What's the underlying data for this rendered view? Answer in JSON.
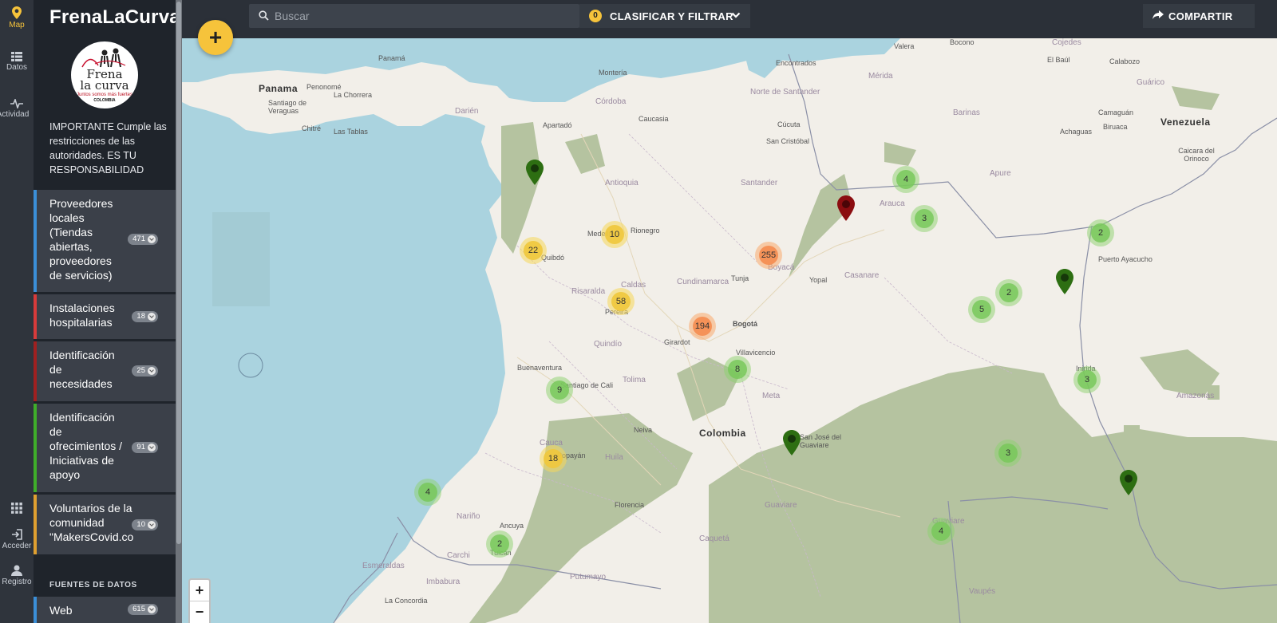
{
  "rail": {
    "items": [
      {
        "label": "Map",
        "icon": "map-pin-icon",
        "active": true
      },
      {
        "label": "Datos",
        "icon": "list-icon"
      },
      {
        "label": "Actividad",
        "icon": "activity-icon"
      },
      {
        "label": "",
        "icon": "apps-grid-icon"
      },
      {
        "label": "Acceder",
        "icon": "login-icon"
      },
      {
        "label": "Registro",
        "icon": "user-icon"
      }
    ]
  },
  "sidebar": {
    "brand": "FrenaLaCurva",
    "logo": {
      "line1": "Frena",
      "line2": "la curva",
      "line3": "Juntos somos más fuertes",
      "line4": "COLOMBIA"
    },
    "notice": "IMPORTANTE Cumple las restricciones de las autoridades. ES TU RESPONSABILIDAD",
    "layers": [
      {
        "label": "Proveedores locales (Tiendas abiertas, proveedores de servicios)",
        "count": "471",
        "color": "#3b8fd8"
      },
      {
        "label": "Instalaciones hospitalarias",
        "count": "18",
        "color": "#d83b3b"
      },
      {
        "label": "Identificación de necesidades",
        "count": "25",
        "color": "#a02020"
      },
      {
        "label": "Identificación de ofrecimientos / Iniciativas de apoyo",
        "count": "91",
        "color": "#3fae2a"
      },
      {
        "label": "Voluntarios de la comunidad \"MakersCovid.co",
        "count": "10",
        "color": "#e0a030"
      }
    ],
    "sources_title": "FUENTES DE DATOS",
    "source_first": {
      "label": "Web",
      "count": "615"
    }
  },
  "topbar": {
    "search_placeholder": "Buscar",
    "filter_count": "0",
    "filter_label": "CLASIFICAR Y FILTRAR",
    "share_label": "COMPARTIR"
  },
  "map": {
    "fab_label": "+",
    "zoom_in": "+",
    "zoom_out": "−",
    "labels": [
      {
        "text": "Panamá",
        "kind": "city"
      },
      {
        "text": "Panama",
        "kind": "country"
      },
      {
        "text": "Venezuela",
        "kind": "country"
      },
      {
        "text": "Colombia",
        "kind": "country"
      },
      {
        "text": "Bogotá",
        "kind": "city"
      },
      {
        "text": "Medellín",
        "kind": "city"
      },
      {
        "text": "Rionegro",
        "kind": "city"
      },
      {
        "text": "Quibdó",
        "kind": "city"
      },
      {
        "text": "Apartadó",
        "kind": "city"
      },
      {
        "text": "Montería",
        "kind": "city"
      },
      {
        "text": "Caucasia",
        "kind": "city"
      },
      {
        "text": "Córdoba",
        "kind": "region"
      },
      {
        "text": "Antioquia",
        "kind": "region"
      },
      {
        "text": "Santander",
        "kind": "region"
      },
      {
        "text": "Norte de Santander",
        "kind": "region"
      },
      {
        "text": "Cúcuta",
        "kind": "city"
      },
      {
        "text": "San Cristóbal",
        "kind": "city"
      },
      {
        "text": "Arauca",
        "kind": "region"
      },
      {
        "text": "Apure",
        "kind": "region"
      },
      {
        "text": "Barinas",
        "kind": "region"
      },
      {
        "text": "Casanare",
        "kind": "region"
      },
      {
        "text": "Yopal",
        "kind": "city"
      },
      {
        "text": "Tunja",
        "kind": "city"
      },
      {
        "text": "Boyacá",
        "kind": "region"
      },
      {
        "text": "Cundinamarca",
        "kind": "region"
      },
      {
        "text": "Girardot",
        "kind": "city"
      },
      {
        "text": "Villavicencio",
        "kind": "city"
      },
      {
        "text": "Meta",
        "kind": "region"
      },
      {
        "text": "Tolima",
        "kind": "region"
      },
      {
        "text": "Quindío",
        "kind": "region"
      },
      {
        "text": "Risaralda",
        "kind": "region"
      },
      {
        "text": "Caldas",
        "kind": "region"
      },
      {
        "text": "Pereira",
        "kind": "city"
      },
      {
        "text": "Buenaventura",
        "kind": "city"
      },
      {
        "text": "Santiago de Cali",
        "kind": "city"
      },
      {
        "text": "Cauca",
        "kind": "region"
      },
      {
        "text": "Popayán",
        "kind": "city"
      },
      {
        "text": "Huila",
        "kind": "region"
      },
      {
        "text": "Neiva",
        "kind": "city"
      },
      {
        "text": "Florencia",
        "kind": "city"
      },
      {
        "text": "Nariño",
        "kind": "region"
      },
      {
        "text": "Ancuya",
        "kind": "city"
      },
      {
        "text": "Tulcán",
        "kind": "city"
      },
      {
        "text": "Esmeraldas",
        "kind": "region"
      },
      {
        "text": "Carchi",
        "kind": "region"
      },
      {
        "text": "Putumayo",
        "kind": "region"
      },
      {
        "text": "Caquetá",
        "kind": "region"
      },
      {
        "text": "Guaviare",
        "kind": "region"
      },
      {
        "text": "San José del Guaviare",
        "kind": "city"
      },
      {
        "text": "Vaupés",
        "kind": "region"
      },
      {
        "text": "Amazonas",
        "kind": "region"
      },
      {
        "text": "Puerto Ayacucho",
        "kind": "city"
      },
      {
        "text": "Caicara del Orinoco",
        "kind": "city"
      },
      {
        "text": "Guárico",
        "kind": "region"
      },
      {
        "text": "Cojedes",
        "kind": "region"
      },
      {
        "text": "Bocono",
        "kind": "city"
      },
      {
        "text": "Valera",
        "kind": "city"
      },
      {
        "text": "Mérida",
        "kind": "region"
      },
      {
        "text": "El Baúl",
        "kind": "city"
      },
      {
        "text": "Calabozo",
        "kind": "city"
      },
      {
        "text": "Camaguán",
        "kind": "city"
      },
      {
        "text": "Biruaca",
        "kind": "city"
      },
      {
        "text": "Achaguas",
        "kind": "city"
      },
      {
        "text": "Encontrados",
        "kind": "city"
      },
      {
        "text": "Darién",
        "kind": "region"
      },
      {
        "text": "La Chorrera",
        "kind": "city"
      },
      {
        "text": "Penonomé",
        "kind": "city"
      },
      {
        "text": "Santiago de Veraguas",
        "kind": "city"
      },
      {
        "text": "Chitré",
        "kind": "city"
      },
      {
        "text": "Las Tablas",
        "kind": "city"
      },
      {
        "text": "Inirida",
        "kind": "city"
      },
      {
        "text": "Guaviare",
        "kind": "region"
      },
      {
        "text": "La Concordia",
        "kind": "city"
      },
      {
        "text": "Imbabura",
        "kind": "region"
      }
    ],
    "clusters": [
      {
        "count": "4",
        "tier": "green"
      },
      {
        "count": "3",
        "tier": "green"
      },
      {
        "count": "2",
        "tier": "green"
      },
      {
        "count": "22",
        "tier": "yellow"
      },
      {
        "count": "10",
        "tier": "yellow"
      },
      {
        "count": "255",
        "tier": "orange"
      },
      {
        "count": "58",
        "tier": "yellow"
      },
      {
        "count": "194",
        "tier": "orange"
      },
      {
        "count": "8",
        "tier": "green"
      },
      {
        "count": "2",
        "tier": "green"
      },
      {
        "count": "5",
        "tier": "green"
      },
      {
        "count": "9",
        "tier": "green"
      },
      {
        "count": "3",
        "tier": "green"
      },
      {
        "count": "18",
        "tier": "yellow"
      },
      {
        "count": "3",
        "tier": "green"
      },
      {
        "count": "4",
        "tier": "green"
      },
      {
        "count": "4",
        "tier": "green"
      },
      {
        "count": "2",
        "tier": "green"
      }
    ],
    "pins": [
      {
        "color": "#2d6e12"
      },
      {
        "color": "#8b0d10"
      },
      {
        "color": "#2d6e12"
      },
      {
        "color": "#2d6e12"
      },
      {
        "color": "#2d6e12"
      }
    ]
  }
}
